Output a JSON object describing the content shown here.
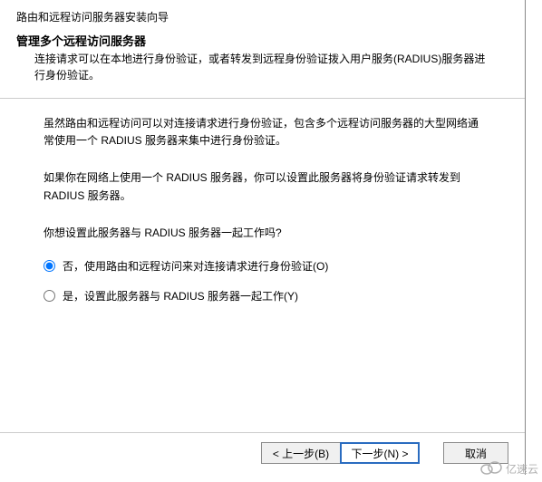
{
  "wizard": {
    "title": "路由和远程访问服务器安装向导"
  },
  "page": {
    "heading": "管理多个远程访问服务器",
    "subtext": "连接请求可以在本地进行身份验证，或者转发到远程身份验证拨入用户服务(RADIUS)服务器进行身份验证。"
  },
  "content": {
    "para1": "虽然路由和远程访问可以对连接请求进行身份验证，包含多个远程访问服务器的大型网络通常使用一个 RADIUS 服务器来集中进行身份验证。",
    "para2": "如果你在网络上使用一个 RADIUS 服务器，你可以设置此服务器将身份验证请求转发到 RADIUS 服务器。",
    "question": "你想设置此服务器与 RADIUS 服务器一起工作吗?"
  },
  "options": {
    "no_label": "否，使用路由和远程访问来对连接请求进行身份验证(O)",
    "yes_label": "是，设置此服务器与 RADIUS 服务器一起工作(Y)"
  },
  "buttons": {
    "back": "< 上一步(B)",
    "next": "下一步(N) >",
    "cancel": "取消"
  },
  "watermark": {
    "text": "亿速云"
  }
}
